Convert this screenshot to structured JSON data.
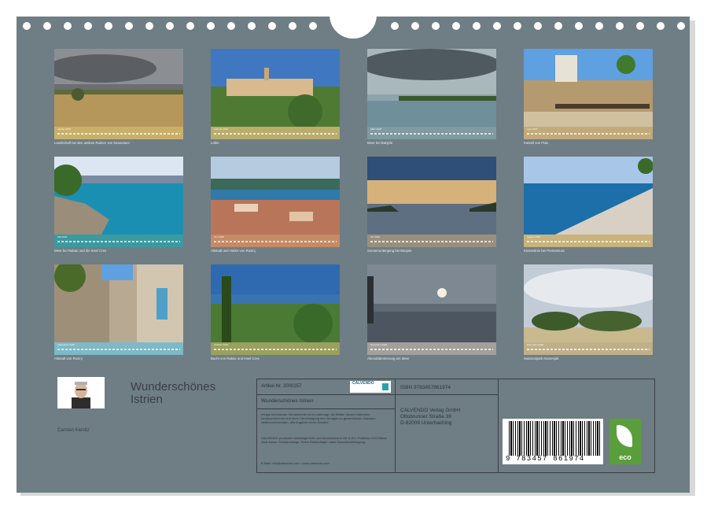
{
  "tiles": [
    {
      "month": "Januar 2026",
      "caption": "Landschaft bei den antiken Ruinen von Nesactium",
      "strip": "#c9b06a"
    },
    {
      "month": "Februar 2026",
      "caption": "Labin",
      "strip": "#b9ad6c"
    },
    {
      "month": "März 2026",
      "caption": "Meer bei Banjole",
      "strip": "#7f9aa0"
    },
    {
      "month": "April 2026",
      "caption": "Kastell von Pula",
      "strip": "#c3aa7b"
    },
    {
      "month": "Mai 2026",
      "caption": "Meer bei Rabac und die Insel Cres",
      "strip": "#3b9aa0"
    },
    {
      "month": "Juni 2026",
      "caption": "Altstadt und Hafen von Rovinj",
      "strip": "#c68a66"
    },
    {
      "month": "Juli 2026",
      "caption": "Sonnenuntergang bei Banjole",
      "strip": "#9a8f7f"
    },
    {
      "month": "August 2026",
      "caption": "Küstenlinie bei Premantura",
      "strip": "#c8b37d"
    },
    {
      "month": "September 2026",
      "caption": "Altstadt von Rovinj",
      "strip": "#7db9c6"
    },
    {
      "month": "Oktober 2026",
      "caption": "Bucht von Rabac und Insel Cres",
      "strip": "#9aa05e"
    },
    {
      "month": "November 2026",
      "caption": "Abenddämmerung am Meer",
      "strip": "#a3a09a"
    },
    {
      "month": "Dezember 2026",
      "caption": "Nationalpark Kamenjak",
      "strip": "#bfb089"
    }
  ],
  "cover": {
    "title_line1": "Wunderschönes",
    "title_line2": "Istrien",
    "author": "Carsten Kienitz"
  },
  "info": {
    "article_no": "Artikel-Nr. 2000257",
    "logo": "CALVENDO",
    "book_title": "Wunderschönes Istrien",
    "disclaimer": "Infolge technischer Schutzrechte ist es untersagt, die Blätter dieses Kalenders herauszutrennen und ohne Genehmigung des Verlages zu gewerblichen Zwecken weiterzuverwenden. Alle Angaben ohne Gewähr.",
    "production": "CALVENDO produziert bedarfsgerecht und klimaneutral in DE & EU. Positives CO2-Bilanz dank kurzer Transportwege. Keine Restauflagen dank Einzelstückfertigung.",
    "email": "E-Mail: info@calvendo.com • www.calvendo.com",
    "isbn": "ISBN 9783457861974",
    "publisher1": "CALVENDO Verlag GmbH",
    "publisher2": "Ottobrunner Straße 39",
    "publisher3": "D-82008 Unterhaching",
    "barcode_number": "9 783457 861974",
    "eco": "eco"
  }
}
